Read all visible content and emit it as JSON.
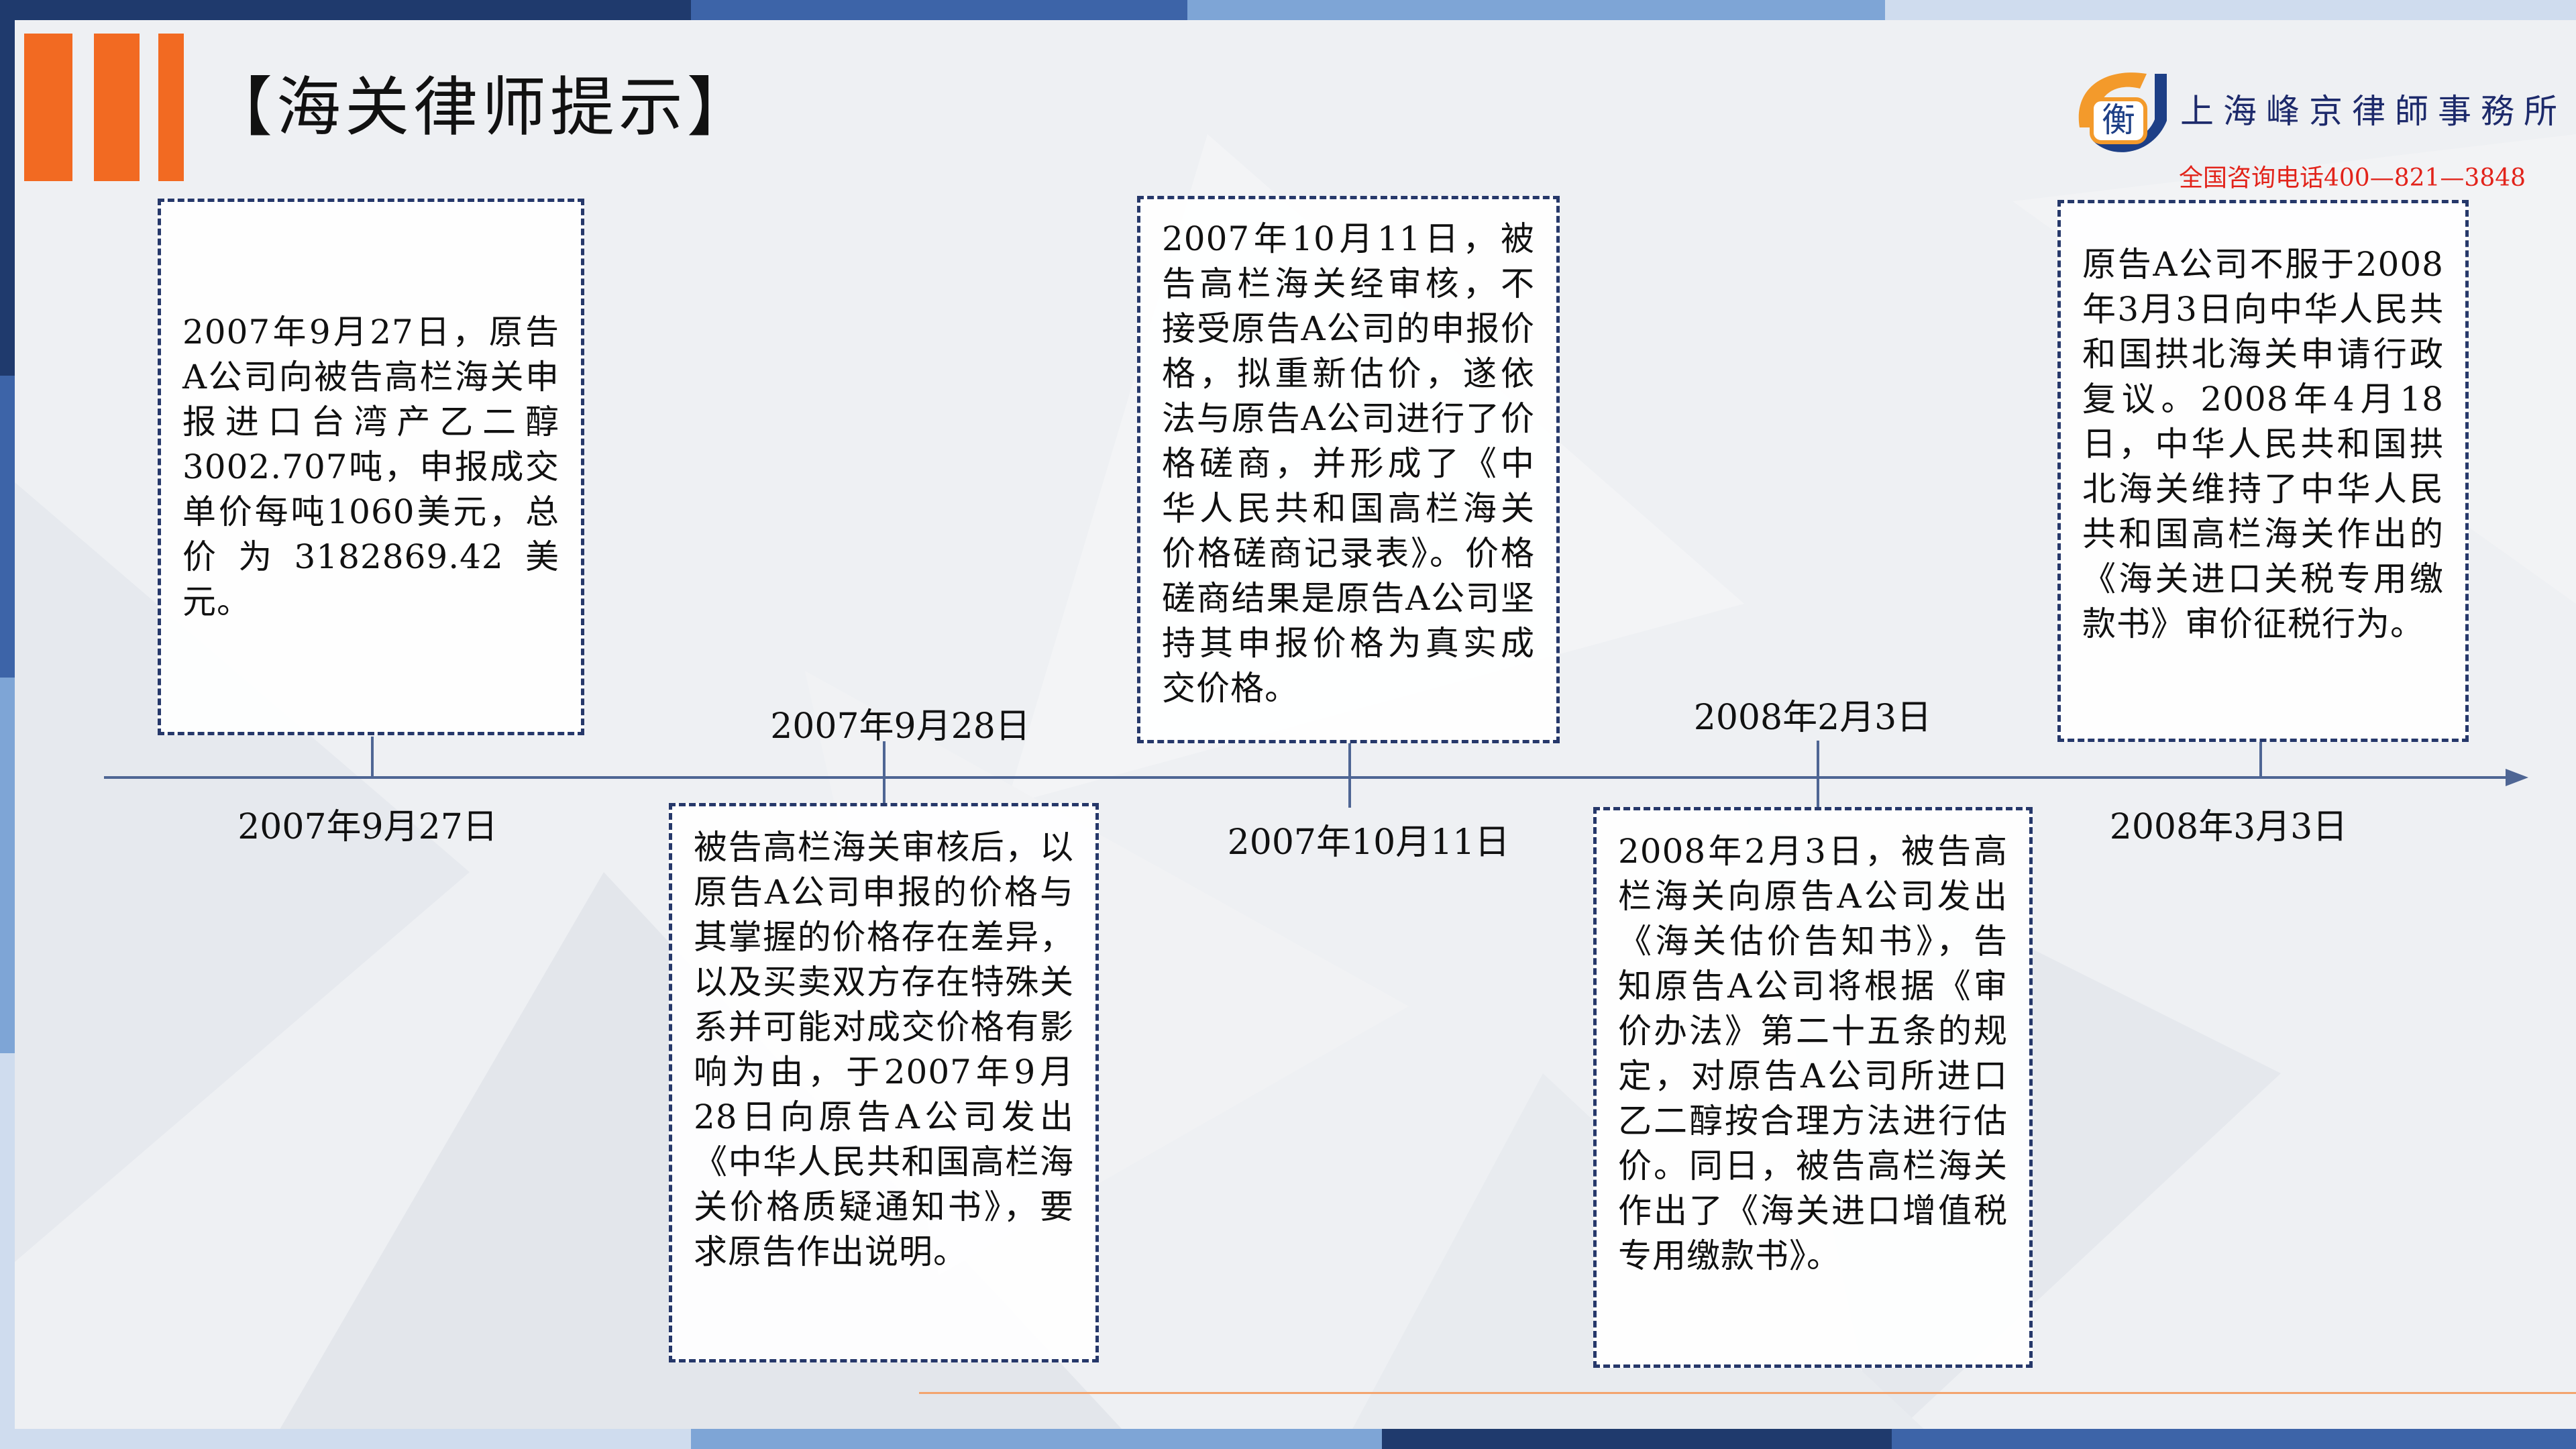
{
  "page": {
    "title": "【海关律师提示】"
  },
  "logo": {
    "mark": "衡",
    "firm_name": "上海峰京律師事務所",
    "phone": "全国咨询电话400—821—3848"
  },
  "timeline": {
    "events": [
      {
        "date": "2007年9月27日",
        "text": "2007年9月27日，原告A公司向被告高栏海关申报进口台湾产乙二醇3002.707吨，申报成交单价每吨1060美元，总价为3182869.42美元。"
      },
      {
        "date": "2007年9月28日",
        "text": "被告高栏海关审核后，以原告A公司申报的价格与其掌握的价格存在差异，以及买卖双方存在特殊关系并可能对成交价格有影响为由，于2007年9月28日向原告A公司发出《中华人民共和国高栏海关价格质疑通知书》，要求原告作出说明。"
      },
      {
        "date": "2007年10月11日",
        "text": "2007年10月11日，被告高栏海关经审核，不接受原告A公司的申报价格，拟重新估价，遂依法与原告A公司进行了价格磋商，并形成了《中华人民共和国高栏海关价格磋商记录表》。价格磋商结果是原告A公司坚持其申报价格为真实成交价格。"
      },
      {
        "date": "2008年2月3日",
        "text": "2008年2月3日，被告高栏海关向原告A公司发出《海关估价告知书》，告知原告A公司将根据《审价办法》第二十五条的规定，对原告A公司所进口乙二醇按合理方法进行估价。同日，被告高栏海关作出了《海关进口增值税专用缴款书》。"
      },
      {
        "date": "2008年3月3日",
        "text": "原告A公司不服于2008年3月3日向中华人民共和国拱北海关申请行政复议。2008年4月18日，中华人民共和国拱北海关维持了中华人民共和国高栏海关作出的《海关进口关税专用缴款书》审价征税行为。"
      }
    ]
  },
  "colors": {
    "accent_orange": "#f26a22",
    "timeline_blue": "#4f6694",
    "card_border": "#26386a",
    "phone_red": "#e2231a",
    "brand_navy": "#1d2a6b"
  }
}
